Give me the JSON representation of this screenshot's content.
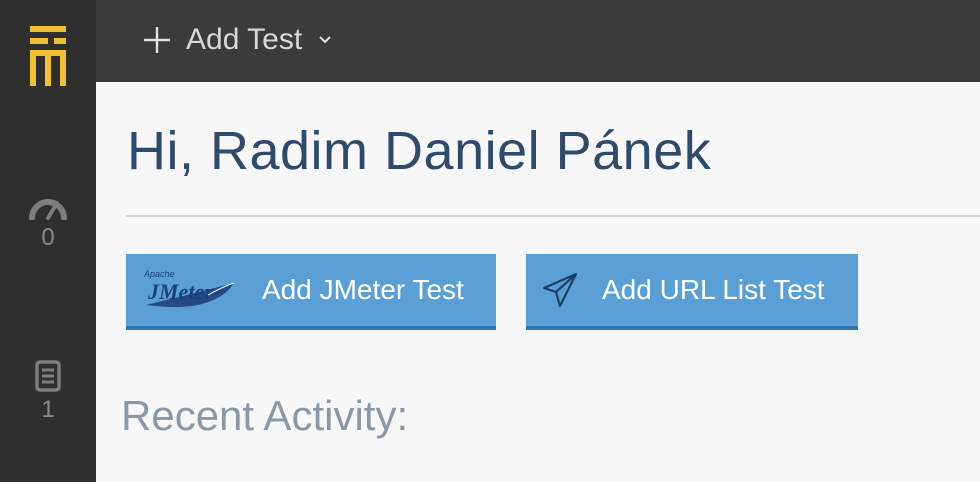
{
  "topbar": {
    "add_test_label": "Add Test"
  },
  "sidebar": {
    "stats": [
      {
        "icon": "speedometer-icon",
        "count": "0"
      },
      {
        "icon": "document-icon",
        "count": "1"
      }
    ]
  },
  "main": {
    "greeting": "Hi, Radim Daniel Pánek",
    "buttons": [
      {
        "label": "Add JMeter Test",
        "icon": "jmeter-logo"
      },
      {
        "label": "Add URL List Test",
        "icon": "send-icon"
      }
    ],
    "recent_label": "Recent Activity:"
  },
  "colors": {
    "sidebar_bg": "#2f2f2f",
    "topbar_bg": "#3b3b3b",
    "logo": "#f2c230",
    "button_bg": "#5aa0d6",
    "button_border": "#2d77b3",
    "heading": "#2f4a6b"
  }
}
